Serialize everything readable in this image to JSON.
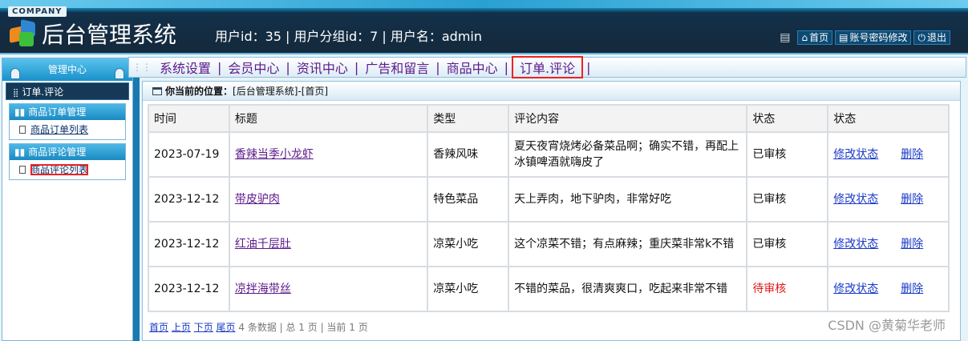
{
  "header": {
    "company": "COMPANY",
    "title": "后台管理系统",
    "user_info": "用户id：35 | 用户分组id：7 | 用户名：admin",
    "links": {
      "home": "首页",
      "change_password": "账号密码修改",
      "logout": "退出"
    }
  },
  "sidebar": {
    "head": "管理中心",
    "section_title": "订单.评论",
    "groups": [
      {
        "title": "商品订单管理",
        "items": [
          "商品订单列表"
        ]
      },
      {
        "title": "商品评论管理",
        "items": [
          "商品评论列表"
        ]
      }
    ]
  },
  "nav": {
    "items": [
      "系统设置",
      "会员中心",
      "资讯中心",
      "广告和留言",
      "商品中心",
      "订单.评论"
    ],
    "active": "订单.评论"
  },
  "breadcrumb": {
    "label": "你当前的位置：",
    "path": "[后台管理系统]-[首页]"
  },
  "table": {
    "headers": [
      "时间",
      "标题",
      "类型",
      "评论内容",
      "状态",
      "状态"
    ],
    "action_labels": {
      "edit": "修改状态",
      "delete": "删除"
    },
    "rows": [
      {
        "time": "2023-07-19",
        "title": "香辣当季小龙虾",
        "type": "香辣风味",
        "content": "夏天夜宵烧烤必备菜品啊；确实不错，再配上冰镇啤酒就嗨皮了",
        "status": "已审核"
      },
      {
        "time": "2023-12-12",
        "title": "带皮驴肉",
        "type": "特色菜品",
        "content": "天上弄肉，地下驴肉，非常好吃",
        "status": "已审核"
      },
      {
        "time": "2023-12-12",
        "title": "红油千层肚",
        "type": "凉菜小吃",
        "content": "这个凉菜不错；有点麻辣；重庆菜非常k不错",
        "status": "已审核"
      },
      {
        "time": "2023-12-12",
        "title": "凉拌海带丝",
        "type": "凉菜小吃",
        "content": "不错的菜品，很清爽爽口，吃起来非常不错",
        "status": "待审核"
      }
    ]
  },
  "pager": {
    "first": "首页",
    "prev": "上页",
    "next": "下页",
    "last": "尾页",
    "summary": "4 条数据 | 总 1 页 | 当前 1 页"
  },
  "watermark": "CSDN @黄菊华老师",
  "colors": {
    "header_bg": "#15293b",
    "accent": "#1a8ac2",
    "pending": "#e01818",
    "link": "#1a3ac8"
  }
}
